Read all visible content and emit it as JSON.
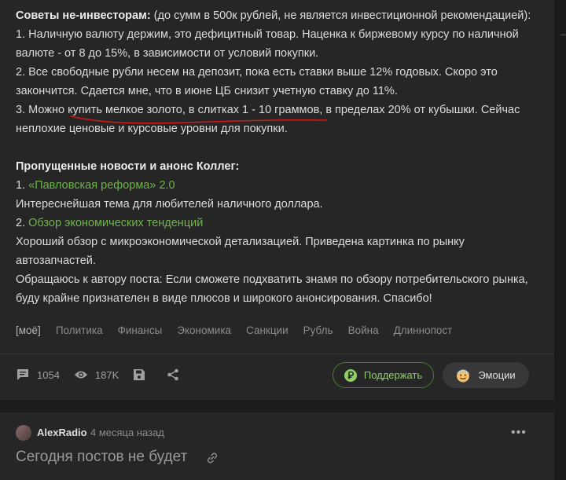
{
  "post": {
    "intro_bold": "Советы не-инвесторам:",
    "intro_rest": " (до сумм в 500к рублей, не является инвестиционной рекомендацией):",
    "point1": "1. Наличную валюту держим, это дефицитный товар. Наценка к биржевому курсу по наличной валюте - от 8 до 15%, в зависимости от условий покупки.",
    "point2": "2. Все свободные рубли несем на депозит, пока есть ставки выше 12% годовых. Скоро это закончится. Сдается мне, что в июне ЦБ снизит учетную ставку до 11%.",
    "point3": "3. Можно купить мелкое золото, в слитках 1 - 10 граммов, в пределах 20% от кубышки. Сейчас неплохие ценовые и курсовые уровни для покупки.",
    "missed_title": "Пропущенные новости и анонс Коллег:",
    "item1_num": "1. ",
    "item1_link": "«Павловская реформа» 2.0",
    "item1_desc": "Интереснейшая тема для любителей наличного доллара.",
    "item2_num": "2. ",
    "item2_link": "Обзор экономических тенденций",
    "item2_desc": "Хороший обзор с микроэкономической детализацией. Приведена картинка по рынку автозапчастей.",
    "appeal": "Обращаюсь к автору поста: Если сможете подхватить знамя по обзору потребительского рынка, буду крайне признателен в виде плюсов и широкого анонсирования. Спасибо!"
  },
  "tags": [
    "[моё]",
    "Политика",
    "Финансы",
    "Экономика",
    "Санкции",
    "Рубль",
    "Война",
    "Длиннопост"
  ],
  "stats": {
    "comments": "1054",
    "views": "187K"
  },
  "buttons": {
    "support": "Поддержать",
    "emotions": "Эмоции"
  },
  "next_post": {
    "author": "AlexRadio",
    "time": "4 месяца назад",
    "more": "•••",
    "title": "Сегодня постов не будет"
  },
  "colors": {
    "accent": "#6fb34c",
    "underline": "#d11a1a",
    "background": "#262626"
  },
  "icons": [
    "comment-icon",
    "eye-icon",
    "save-icon",
    "share-icon",
    "ruble-icon",
    "emotion-face-icon",
    "link-icon",
    "more-icon"
  ]
}
